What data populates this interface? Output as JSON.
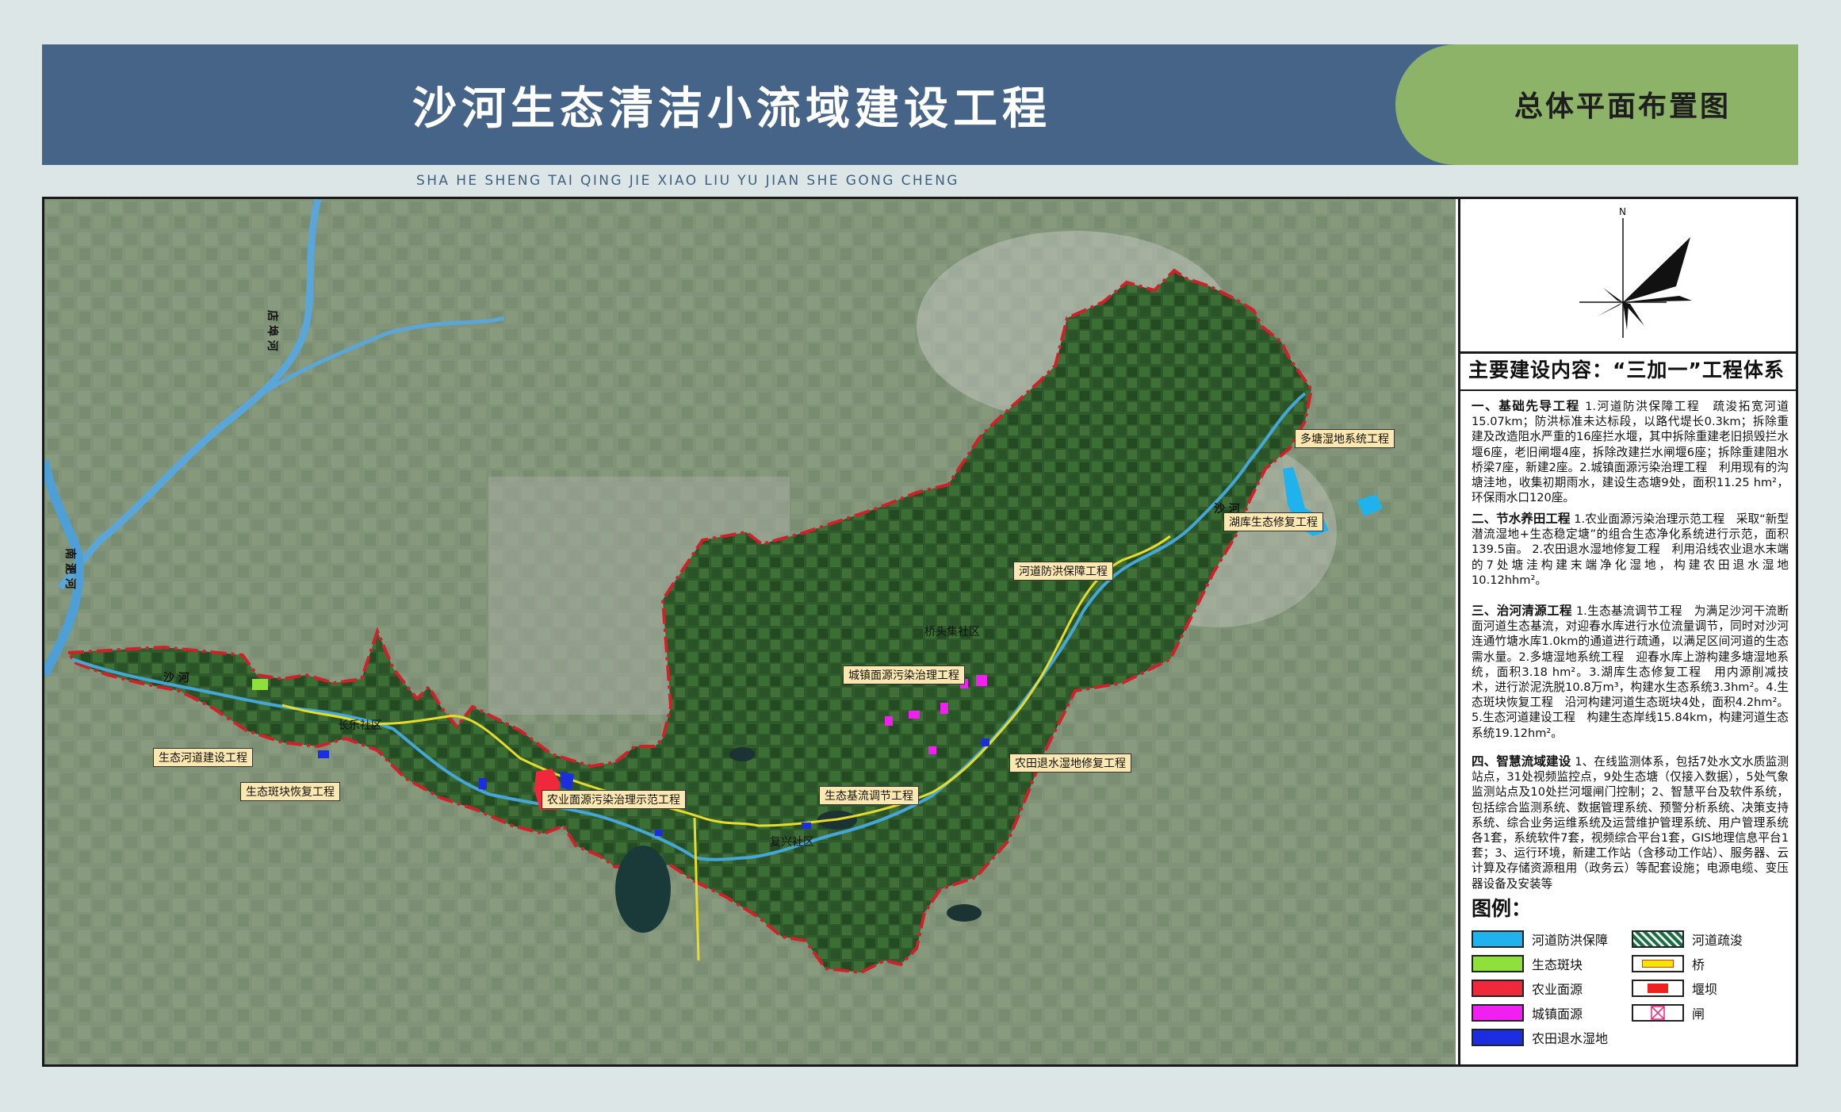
{
  "header": {
    "title": "沙河生态清洁小流域建设工程",
    "badge": "总体平面布置图",
    "pinyin": "SHA HE SHENG TAI QING JIE XIAO LIU YU JIAN SHE GONG CHENG"
  },
  "compass": {
    "north_label": "N"
  },
  "content": {
    "heading": "主要建设内容：“三加一”工程体系",
    "sections": [
      {
        "title": "一、基础先导工程",
        "text": "1.河道防洪保障工程　疏浚拓宽河道15.07km；防洪标准未达标段，以路代堤长0.3km；拆除重建及改造阻水严重的16座拦水堰，其中拆除重建老旧损毁拦水堰6座，老旧闸堰4座，拆除改建拦水闸堰6座；拆除重建阻水桥梁7座，新建2座。2.城镇面源污染治理工程　利用现有的沟塘洼地，收集初期雨水，建设生态塘9处，面积11.25 hm²，环保雨水口120座。"
      },
      {
        "title": "二、节水养田工程",
        "text": "1.农业面源污染治理示范工程　采取“新型潜流湿地+生态稳定塘”的组合生态净化系统进行示范，面积139.5亩。 2.农田退水湿地修复工程　利用沿线农业退水末端的7处塘洼构建末端净化湿地，构建农田退水湿地10.12hhm²。"
      },
      {
        "title": "三、治河清源工程",
        "text": "1.生态基流调节工程　为满足沙河干流断面河道生态基流，对迎春水库进行水位流量调节，同时对沙河连通竹塘水库1.0km的通道进行疏通，以满足区间河道的生态需水量。2.多塘湿地系统工程　迎春水库上游构建多塘湿地系统，面积3.18 hm²。3.湖库生态修复工程　用内源削减技术，进行淤泥洗脱10.8万m³，构建水生态系统3.3hm²。4.生态斑块恢复工程　沿河构建河道生态斑块4处，面积4.2hm²。5.生态河道建设工程　构建生态岸线15.84km，构建河道生态系统19.12hm²。"
      },
      {
        "title": "四、智慧流域建设",
        "text": "1、在线监测体系，包括7处水文水质监测站点，31处视频监控点，9处生态塘（仅接入数据），5处气象监测站点及10处拦河堰闸门控制；2、智慧平台及软件系统，包括综合监测系统、数据管理系统、预警分析系统、决策支持系统、综合业务运维系统及运营维护管理系统、用户管理系统各1套，系统软件7套，视频综合平台1套，GIS地理信息平台1套；3、运行环境，新建工作站（含移动工作站）、服务器、云计算及存储资源租用（政务云）等配套设施；电源电缆、变压器设备及安装等"
      }
    ]
  },
  "legend": {
    "title": "图例：",
    "items": [
      {
        "label": "河道防洪保障",
        "color": "#1fb2ec",
        "kind": "fill"
      },
      {
        "label": "河道疏浚",
        "color": "#1d6b4a",
        "kind": "hatch"
      },
      {
        "label": "生态斑块",
        "color": "#8fe03a",
        "kind": "fill"
      },
      {
        "label": "桥",
        "color": "#f3e600",
        "kind": "bridge"
      },
      {
        "label": "农业面源",
        "color": "#f0283c",
        "kind": "fill"
      },
      {
        "label": "堰坝",
        "color": "#f02020",
        "kind": "dam"
      },
      {
        "label": "城镇面源",
        "color": "#f020f0",
        "kind": "fill"
      },
      {
        "label": "闸",
        "color": "#f02080",
        "kind": "gate"
      },
      {
        "label": "农田退水湿地",
        "color": "#1a2ee0",
        "kind": "fill"
      }
    ]
  },
  "map": {
    "place_labels": [
      "长乐社区",
      "桥头集社区",
      "复兴社区"
    ],
    "river_labels": [
      "沙 河",
      "沙 河",
      "店 埠 河",
      "南 淝 河"
    ],
    "project_labels": [
      "多塘湿地系统工程",
      "湖库生态修复工程",
      "河道防洪保障工程",
      "城镇面源污染治理工程",
      "农田退水湿地修复工程",
      "生态河道建设工程",
      "生态斑块恢复工程",
      "农业面源污染治理示范工程",
      "生态基流调节工程"
    ]
  }
}
